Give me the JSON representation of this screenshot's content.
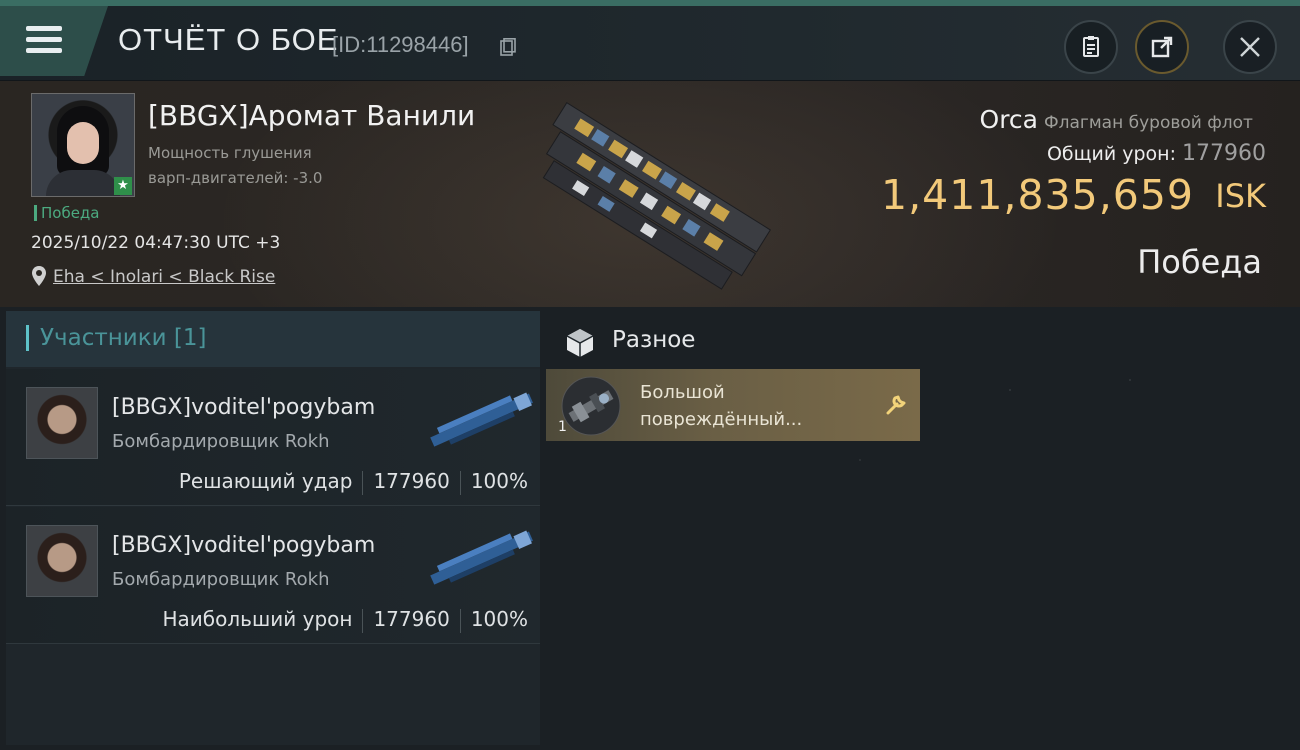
{
  "header": {
    "title": "ОТЧЁТ О БОЕ",
    "report_id": "[ID:11298446]"
  },
  "victim": {
    "name": "[BBGX]Аромат Ванили",
    "attribute_line1": "Мощность глушения",
    "attribute_line2": "варп-двигателей: -3.0",
    "result_tag": "Победа",
    "timestamp": "2025/10/22 04:47:30 UTC +3",
    "location": "Eha < Inolari < Black Rise",
    "ship_name": "Orca",
    "ship_class": "Флагман буровой флот",
    "total_damage_label": "Общий урон:",
    "total_damage_value": "177960",
    "isk_value": "1,411,835,659",
    "isk_unit": "ISK",
    "outcome": "Победа"
  },
  "participants": {
    "header": "Участники [1]",
    "rows": [
      {
        "name": "[BBGX]voditel'pogybam",
        "ship": "Бомбардировщик Rokh",
        "role": "Решающий удар",
        "damage": "177960",
        "percent": "100%"
      },
      {
        "name": "[BBGX]voditel'pogybam",
        "ship": "Бомбардировщик Rokh",
        "role": "Наибольший урон",
        "damage": "177960",
        "percent": "100%"
      }
    ]
  },
  "misc": {
    "header": "Разное",
    "items": [
      {
        "name": "Большой повреждённый...",
        "quantity": "1",
        "icon": "wrench-icon"
      }
    ]
  },
  "colors": {
    "accent_teal": "#5ec2c9",
    "isk_gold": "#f2c97a",
    "victory_green": "#4caa80",
    "item_card": "#7a6a49"
  }
}
